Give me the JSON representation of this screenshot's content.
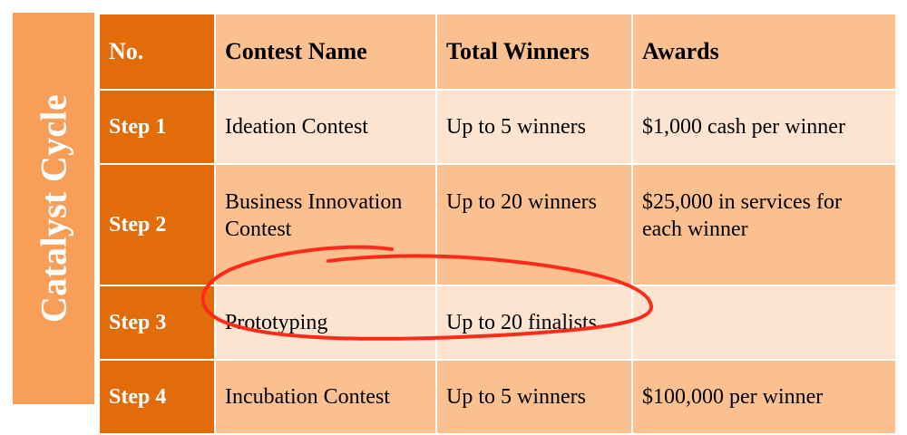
{
  "side_title": "Catalyst Cycle",
  "columns": [
    "No.",
    "Contest Name",
    "Total Winners",
    "Awards"
  ],
  "rows": [
    {
      "step": "Step 1",
      "contest": "Ideation Contest",
      "winners": "Up to 5 winners",
      "awards": "$1,000 cash per winner"
    },
    {
      "step": "Step 2",
      "contest": "Business Innovation Contest",
      "winners": "Up to 20 winners",
      "awards": "$25,000 in services for each winner"
    },
    {
      "step": "Step 3",
      "contest": "Prototyping",
      "winners": "Up to 20 finalists",
      "awards": ""
    },
    {
      "step": "Step 4",
      "contest": "Incubation Contest",
      "winners": "Up to 5 winners",
      "awards": "$100,000 per winner"
    }
  ],
  "colors": {
    "side_panel": "#f79e59",
    "step_column": "#e26b0a",
    "header_cells": "#fac090",
    "light_rows": "#fde4d0",
    "annotation_stroke": "#ff2a1a"
  },
  "annotation": {
    "shape": "hand-drawn-ellipse",
    "highlights_row": "Step 3"
  }
}
